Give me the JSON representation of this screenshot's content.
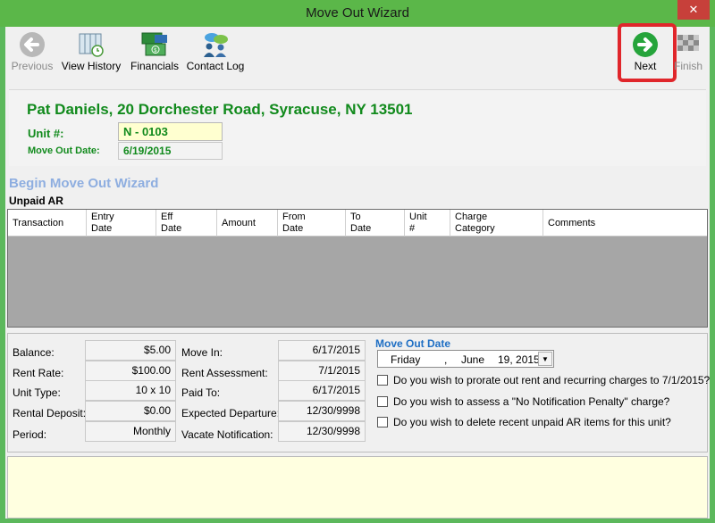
{
  "window": {
    "title": "Move Out Wizard",
    "close_glyph": "✕"
  },
  "toolbar": {
    "previous": "Previous",
    "view_history": "View History",
    "financials": "Financials",
    "contact_log": "Contact Log",
    "next": "Next",
    "finish": "Finish"
  },
  "header": {
    "tenant_line": "Pat Daniels, 20 Dorchester Road, Syracuse, NY  13501",
    "unit_label": "Unit #:",
    "unit_value": "N - 0103",
    "move_out_label": "Move Out Date:",
    "move_out_value": "6/19/2015"
  },
  "wizard": {
    "title": "Begin Move Out Wizard",
    "section": "Unpaid AR"
  },
  "grid": {
    "columns": [
      {
        "l1": "Transaction",
        "l2": ""
      },
      {
        "l1": "Entry",
        "l2": "Date"
      },
      {
        "l1": "Eff",
        "l2": "Date"
      },
      {
        "l1": "Amount",
        "l2": ""
      },
      {
        "l1": "From",
        "l2": "Date"
      },
      {
        "l1": "To",
        "l2": "Date"
      },
      {
        "l1": "Unit",
        "l2": "#"
      },
      {
        "l1": "Charge",
        "l2": "Category"
      },
      {
        "l1": "Comments",
        "l2": ""
      }
    ]
  },
  "info": {
    "balance_label": "Balance:",
    "balance": "$5.00",
    "rent_rate_label": "Rent Rate:",
    "rent_rate": "$100.00",
    "unit_type_label": "Unit Type:",
    "unit_type": "10 x 10",
    "rental_deposit_label": "Rental Deposit:",
    "rental_deposit": "$0.00",
    "period_label": "Period:",
    "period": "Monthly",
    "move_in_label": "Move In:",
    "move_in": "6/17/2015",
    "rent_assessment_label": "Rent Assessment:",
    "rent_assessment": "7/1/2015",
    "paid_to_label": "Paid To:",
    "paid_to": "6/17/2015",
    "expected_departure_label": "Expected Departure:",
    "expected_departure": "12/30/9998",
    "vacate_notification_label": "Vacate Notification:",
    "vacate_notification": "12/30/9998"
  },
  "move_out": {
    "title": "Move Out Date",
    "weekday": "Friday",
    "comma": ",",
    "month": "June",
    "day_year": "19, 2015",
    "options": [
      "Do you wish to prorate out rent and recurring charges to 7/1/2015?",
      "Do you wish to assess a \"No Notification Penalty\" charge?",
      "Do you wish to delete recent unpaid AR items for this unit?"
    ]
  },
  "colors": {
    "title_bar": "#5bb749",
    "tenant_green": "#118a1c",
    "highlight_red": "#e0262b",
    "link_blue": "#1f6fc4"
  }
}
